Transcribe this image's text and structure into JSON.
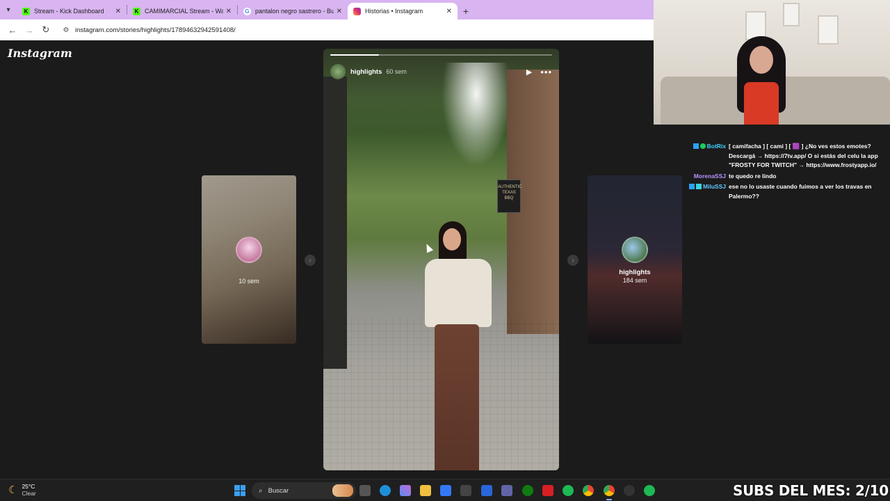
{
  "browser": {
    "tabs": [
      {
        "title": "Stream - Kick Dashboard",
        "favicon": "kick-icon",
        "active": false
      },
      {
        "title": "CAMIMARCIAL Stream - Watch",
        "favicon": "kick-icon",
        "active": false
      },
      {
        "title": "pantalon negro sastrero - Busc",
        "favicon": "google-icon",
        "active": false
      },
      {
        "title": "Historias • Instagram",
        "favicon": "instagram-icon",
        "active": true
      }
    ],
    "url": "instagram.com/stories/highlights/17894632942591408/"
  },
  "instagram": {
    "logo": "Instagram",
    "main_story": {
      "user": "highlights",
      "time": "60 sem",
      "progress": 0.22,
      "sign_text": "AUTHENTIC TEXAS BBQ"
    },
    "prev_story": {
      "time": "10 sem"
    },
    "next_story": {
      "user": "highlights",
      "time": "184 sem"
    }
  },
  "chat": {
    "messages": [
      {
        "user": "BotRix",
        "text": "[ camifacha ] [ cami ] [ 🟪 ] ¿No ves estos emotes? Descargá → https://7tv.app/ O si estás del celu la app \"FROSTY FOR TWITCH\" → https://www.frostyapp.io/"
      },
      {
        "user": "MorenaSSJ",
        "text": "te quedo re lindo"
      },
      {
        "user": "MiluSSJ",
        "text": "ese no lo usaste cuando fuimos a ver los travas en Palermo??"
      }
    ]
  },
  "taskbar": {
    "weather_temp": "25°C",
    "weather_desc": "Clear",
    "search_placeholder": "Buscar",
    "overlay_text": "SUBS DEL MES: 2/10"
  },
  "colors": {
    "tab_strip": "#d8b4f0",
    "page_bg": "#1b1b1b",
    "botrix": "#3fd0ff",
    "morena": "#b993ff",
    "milu": "#5fc8ff"
  }
}
